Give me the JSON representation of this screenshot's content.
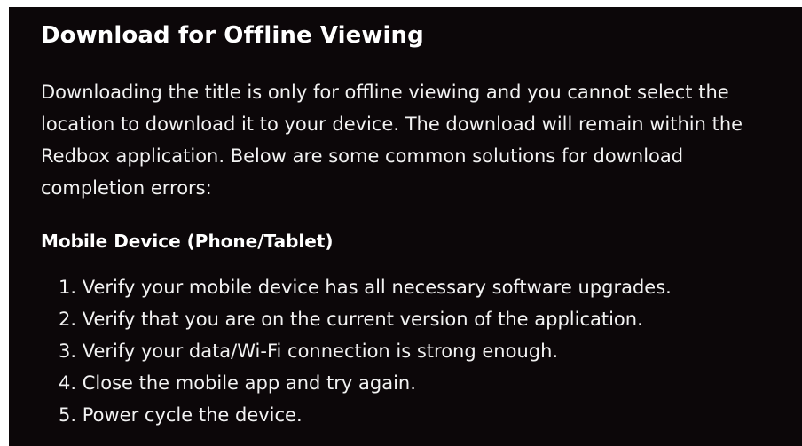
{
  "article": {
    "title": "Download for Offline Viewing",
    "paragraph": "Downloading the title is only for offline viewing and you cannot select the location to download it to your device. The download will remain within the Redbox application. Below are some common solutions for download completion errors:",
    "subheading": "Mobile Device (Phone/Tablet)",
    "steps": [
      {
        "num": "1",
        "text": "Verify your mobile device has all necessary software upgrades."
      },
      {
        "num": "2",
        "text": "Verify that you are on the current version of the application."
      },
      {
        "num": "3",
        "text": "Verify your data/Wi-Fi connection is strong enough."
      },
      {
        "num": "4",
        "text": "Close the mobile app and try again."
      },
      {
        "num": "5",
        "text": "Power cycle the device."
      }
    ]
  },
  "colors": {
    "background": "#0c0709",
    "text": "#ffffff"
  }
}
